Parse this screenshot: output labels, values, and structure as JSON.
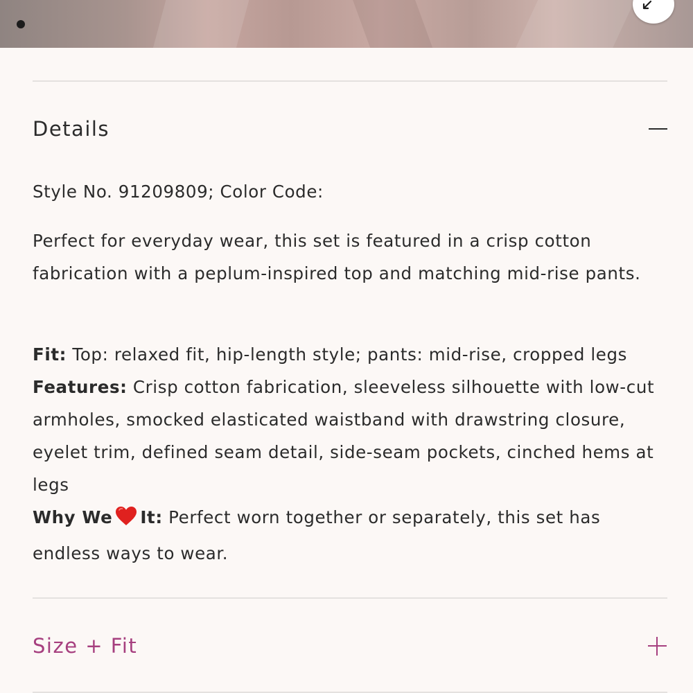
{
  "product_image": {
    "alt": "Product image",
    "slide_indicator_icon": "carousel-dot-icon",
    "expand_icon": "expand-arrows-icon"
  },
  "details": {
    "title": "Details",
    "toggle_icon": "minus-icon",
    "style_line": "Style No. 91209809; Color Code:",
    "description": "Perfect for everyday wear, this set is featured in a crisp cotton fabrication with a peplum-inspired top and matching mid-rise pants.",
    "fit_label": "Fit:",
    "fit_text": " Top: relaxed fit, hip-length style; pants: mid-rise, cropped legs",
    "features_label": "Features:",
    "features_text": " Crisp cotton fabrication, sleeveless silhouette with low-cut armholes, smocked elasticated waistband with drawstring closure, eyelet trim, defined seam detail, side-seam pockets, cinched hems at legs",
    "why_label_start": "Why We",
    "why_icon": "heart-icon",
    "why_label_end": "It:",
    "why_text": " Perfect worn together or separately, this set has endless ways to wear."
  },
  "size_fit": {
    "title": "Size + Fit",
    "toggle_icon": "plus-icon"
  },
  "colors": {
    "accent": "#a63f7f",
    "text": "#2b2b2b",
    "background": "#fcf8f6",
    "divider": "#e4e1df",
    "heart": "#e0211f"
  }
}
